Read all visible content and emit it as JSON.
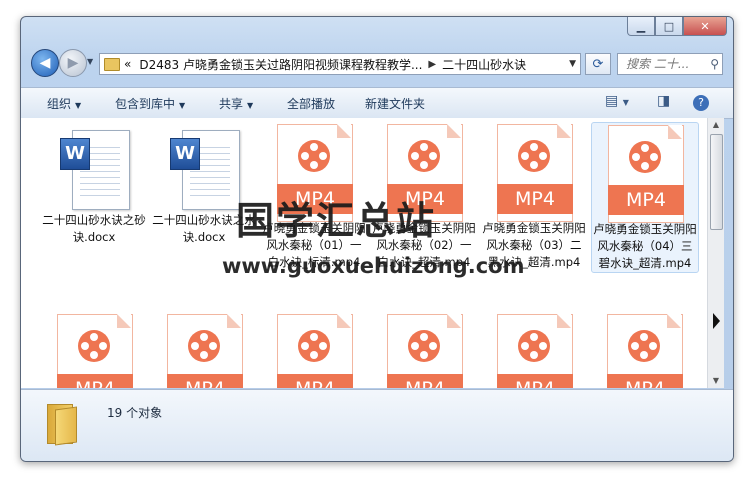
{
  "window": {
    "minimize_glyph": "▁",
    "maximize_glyph": "□",
    "close_glyph": "✕"
  },
  "nav": {
    "back_glyph": "◀",
    "forward_glyph": "▶",
    "address_prefix": "«",
    "breadcrumb": [
      "D2483 卢晓勇金锁玉关过路阴阳视频课程教程教学...",
      "二十四山砂水诀"
    ],
    "search_placeholder": "搜索 二十..."
  },
  "toolbar": {
    "organize": "组织",
    "include_in_library": "包含到库中",
    "share": "共享",
    "play_all": "全部播放",
    "new_folder": "新建文件夹"
  },
  "files": [
    {
      "name": "二十四山砂水诀之砂诀.docx",
      "type": "docx"
    },
    {
      "name": "二十四山砂水诀之水诀.docx",
      "type": "docx"
    },
    {
      "name": "卢晓勇金锁玉关阴阳风水秦秘（01）一白水诀_标清.mp4",
      "type": "mp4",
      "badge": "MP4"
    },
    {
      "name": "卢晓勇金锁玉关阴阳风水秦秘（02）一白水诀_超清.mp4",
      "type": "mp4",
      "badge": "MP4"
    },
    {
      "name": "卢晓勇金锁玉关阴阳风水秦秘（03）二黑水诀_超清.mp4",
      "type": "mp4",
      "badge": "MP4"
    },
    {
      "name": "卢晓勇金锁玉关阴阳风水秦秘（04）三碧水诀_超清.mp4",
      "type": "mp4",
      "badge": "MP4",
      "selected": true
    },
    {
      "name": "",
      "type": "mp4",
      "badge": "MP4"
    },
    {
      "name": "",
      "type": "mp4",
      "badge": "MP4"
    },
    {
      "name": "",
      "type": "mp4",
      "badge": "MP4"
    },
    {
      "name": "",
      "type": "mp4",
      "badge": "MP4"
    },
    {
      "name": "",
      "type": "mp4",
      "badge": "MP4"
    },
    {
      "name": "",
      "type": "mp4",
      "badge": "MP4"
    }
  ],
  "status": {
    "count": "19 个对象"
  },
  "watermark": {
    "text": "国学汇总站",
    "url": "www.guoxuehuizong.com"
  },
  "colors": {
    "mp4_accent": "#ee7551",
    "selection": "#eaf3fd"
  }
}
